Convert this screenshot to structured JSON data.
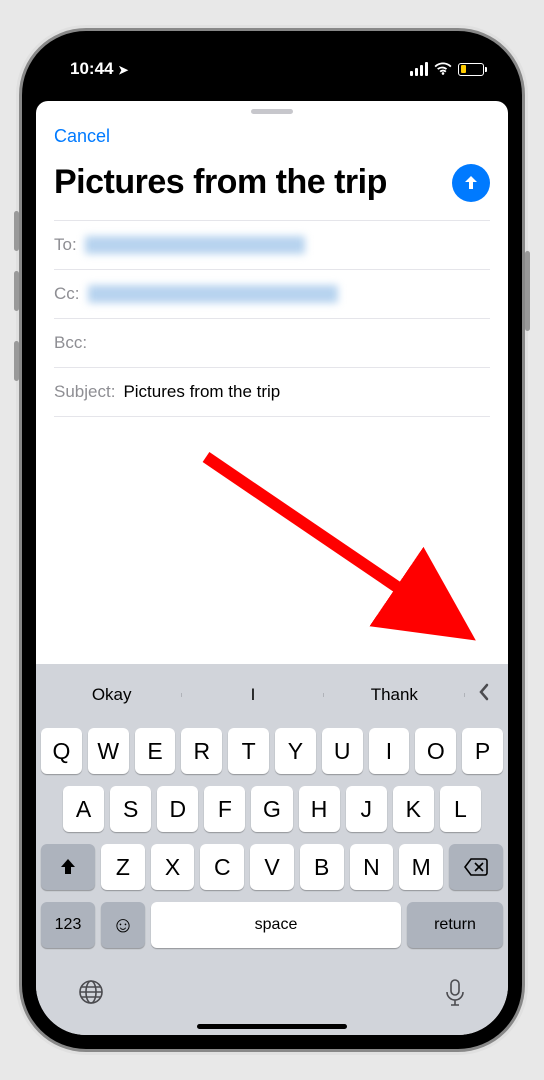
{
  "status": {
    "time": "10:44",
    "location_glyph": "➤"
  },
  "header": {
    "cancel": "Cancel"
  },
  "compose": {
    "title": "Pictures from the trip",
    "to_label": "To:",
    "cc_label": "Cc:",
    "bcc_label": "Bcc:",
    "subject_label": "Subject:",
    "subject_value": "Pictures from the trip"
  },
  "suggestions": [
    "Okay",
    "I",
    "Thank"
  ],
  "keyboard": {
    "row1": [
      "Q",
      "W",
      "E",
      "R",
      "T",
      "Y",
      "U",
      "I",
      "O",
      "P"
    ],
    "row2": [
      "A",
      "S",
      "D",
      "F",
      "G",
      "H",
      "J",
      "K",
      "L"
    ],
    "row3": [
      "Z",
      "X",
      "C",
      "V",
      "B",
      "N",
      "M"
    ],
    "numbers": "123",
    "space": "space",
    "return": "return"
  }
}
